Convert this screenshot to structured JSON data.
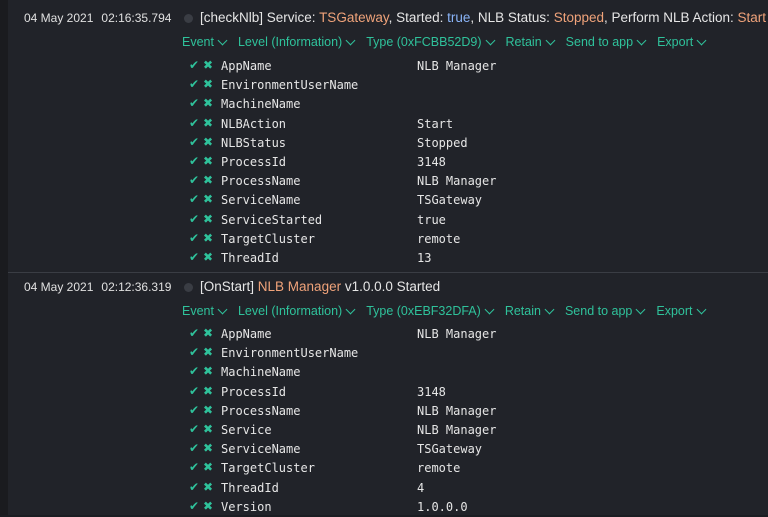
{
  "colors": {
    "accent": "#2fc29b",
    "highlight_orange": "#f0a37a",
    "highlight_blue": "#8ab4f8"
  },
  "events": [
    {
      "date": "04 May 2021",
      "time": "02:16:35.794",
      "message": [
        {
          "text": "[checkNlb] Service: ",
          "style": "plain"
        },
        {
          "text": "TSGateway",
          "style": "orange"
        },
        {
          "text": ", Started: ",
          "style": "plain"
        },
        {
          "text": "true",
          "style": "blue"
        },
        {
          "text": ", NLB Status: ",
          "style": "plain"
        },
        {
          "text": "Stopped",
          "style": "orange"
        },
        {
          "text": ", Perform NLB Action: ",
          "style": "plain"
        },
        {
          "text": "Start",
          "style": "orange"
        }
      ],
      "actions": [
        "Event",
        "Level (Information)",
        "Type (0xFCBB52D9)",
        "Retain",
        "Send to app",
        "Export"
      ],
      "properties": [
        {
          "name": "AppName",
          "value": "NLB Manager"
        },
        {
          "name": "EnvironmentUserName",
          "value": ""
        },
        {
          "name": "MachineName",
          "value": ""
        },
        {
          "name": "NLBAction",
          "value": "Start"
        },
        {
          "name": "NLBStatus",
          "value": "Stopped"
        },
        {
          "name": "ProcessId",
          "value": "3148"
        },
        {
          "name": "ProcessName",
          "value": "NLB Manager"
        },
        {
          "name": "ServiceName",
          "value": "TSGateway"
        },
        {
          "name": "ServiceStarted",
          "value": "true"
        },
        {
          "name": "TargetCluster",
          "value": "remote"
        },
        {
          "name": "ThreadId",
          "value": "13"
        }
      ]
    },
    {
      "date": "04 May 2021",
      "time": "02:12:36.319",
      "message": [
        {
          "text": "[OnStart] ",
          "style": "plain"
        },
        {
          "text": "NLB Manager",
          "style": "orange"
        },
        {
          "text": " v1.0.0.0 Started",
          "style": "plain"
        }
      ],
      "actions": [
        "Event",
        "Level (Information)",
        "Type (0xEBF32DFA)",
        "Retain",
        "Send to app",
        "Export"
      ],
      "properties": [
        {
          "name": "AppName",
          "value": "NLB Manager"
        },
        {
          "name": "EnvironmentUserName",
          "value": ""
        },
        {
          "name": "MachineName",
          "value": ""
        },
        {
          "name": "ProcessId",
          "value": "3148"
        },
        {
          "name": "ProcessName",
          "value": "NLB Manager"
        },
        {
          "name": "Service",
          "value": "NLB Manager"
        },
        {
          "name": "ServiceName",
          "value": "TSGateway"
        },
        {
          "name": "TargetCluster",
          "value": "remote"
        },
        {
          "name": "ThreadId",
          "value": "4"
        },
        {
          "name": "Version",
          "value": "1.0.0.0"
        }
      ]
    }
  ]
}
